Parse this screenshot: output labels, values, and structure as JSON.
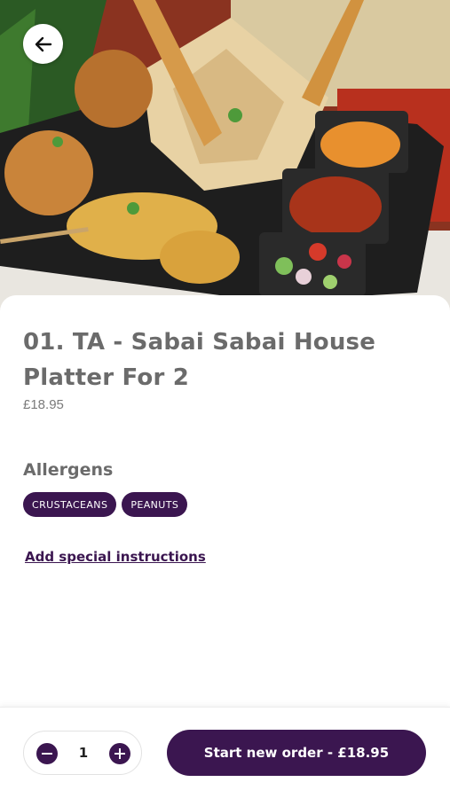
{
  "item": {
    "title": "01. TA - Sabai Sabai House Platter For 2",
    "price": "£18.95"
  },
  "allergens": {
    "heading": "Allergens",
    "tags": [
      "CRUSTACEANS",
      "PEANUTS"
    ]
  },
  "special_instructions_link": "Add special instructions",
  "footer": {
    "quantity": "1",
    "order_button_label": "Start new order - £18.95"
  },
  "icons": {
    "back": "arrow-left-icon",
    "decrease": "minus-icon",
    "increase": "plus-icon"
  },
  "colors": {
    "accent": "#3b1650",
    "heading_text": "#6b6b6b",
    "body_text": "#7a7a7a"
  }
}
